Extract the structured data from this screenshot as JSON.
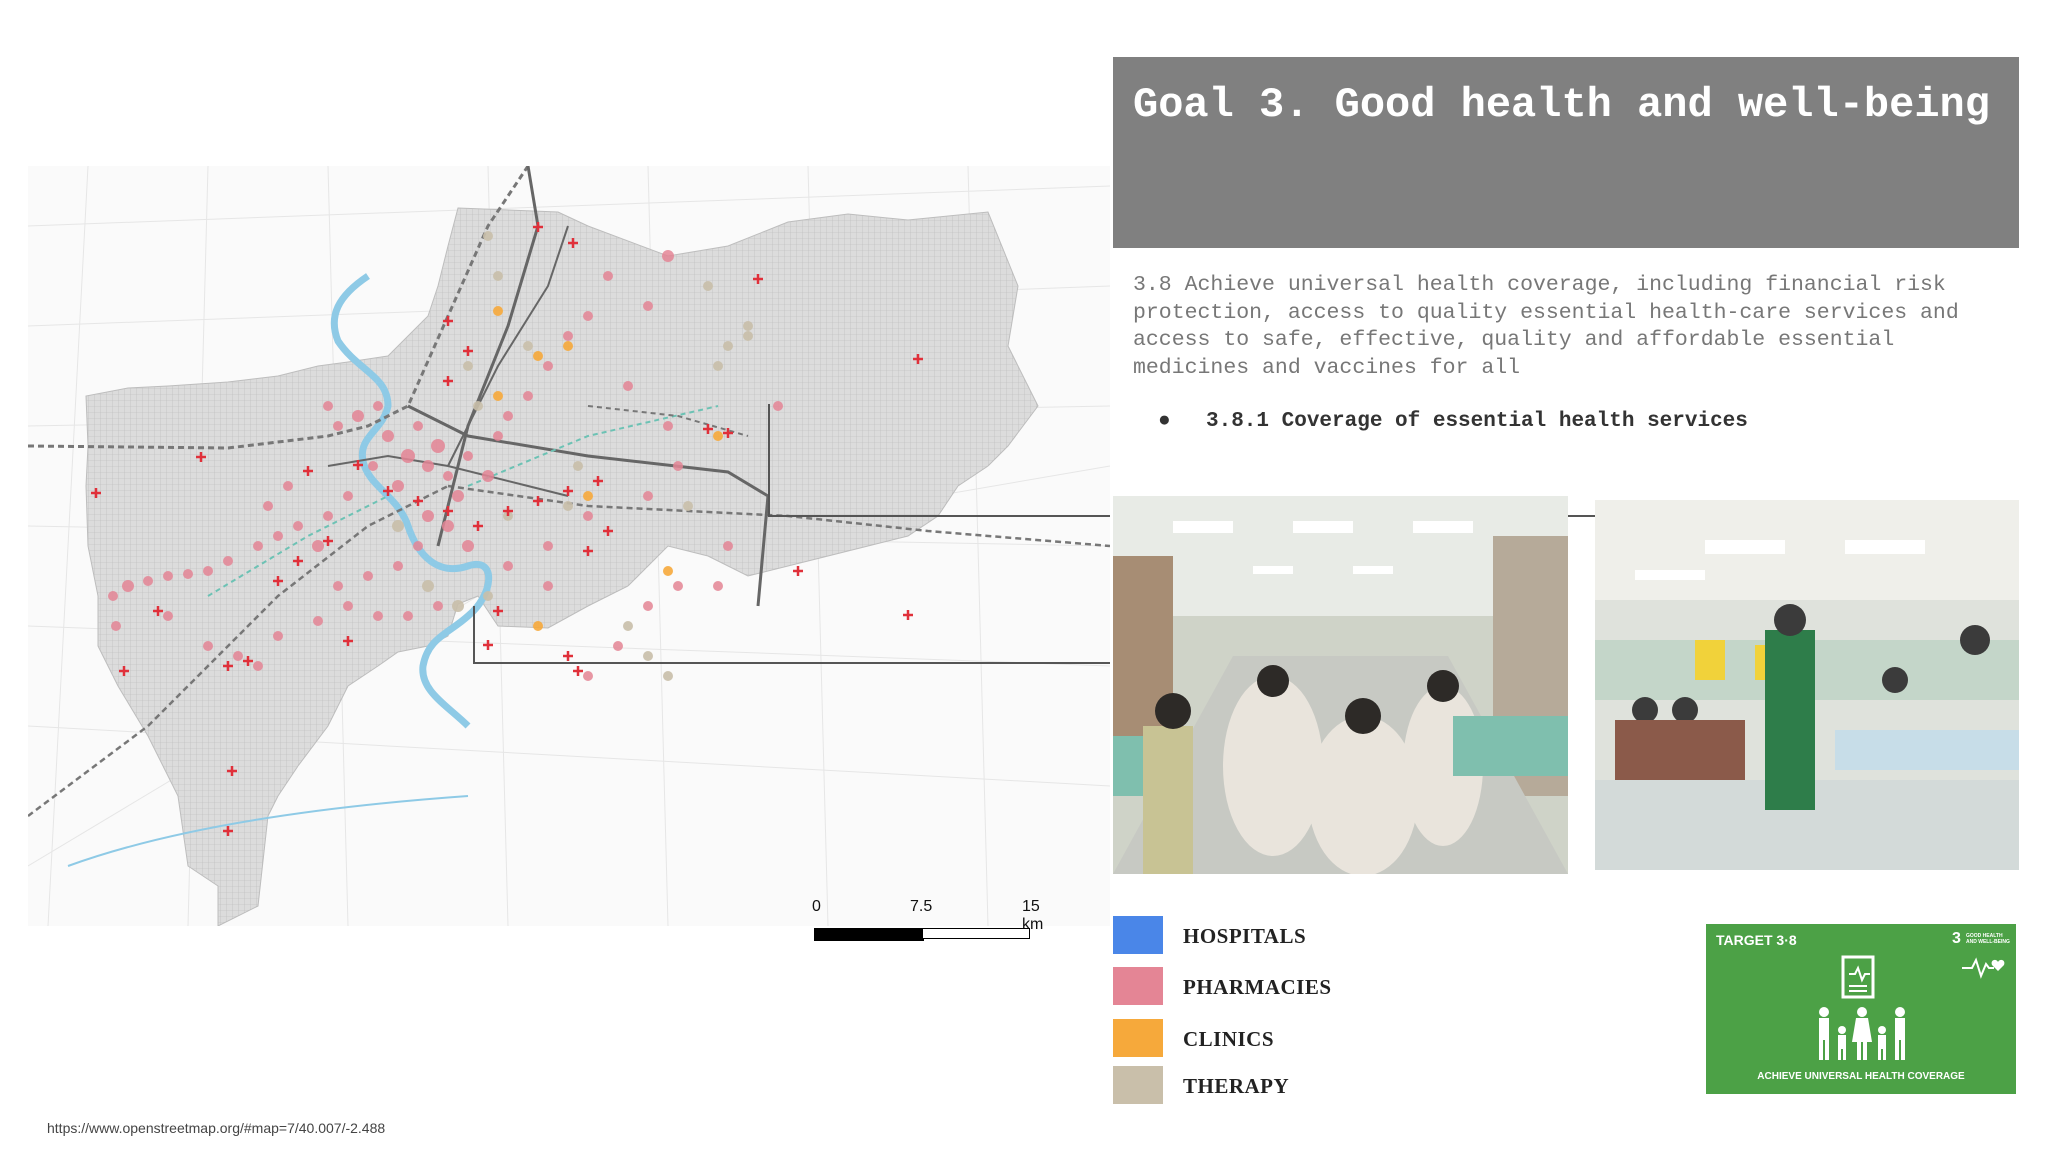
{
  "title": "Goal 3. Good health and well-being",
  "target_text": "3.8 Achieve universal health coverage, including financial risk protection, access to quality essential health-care services and access to safe, effective, quality and affordable essential medicines and vaccines for all",
  "indicator": {
    "bullet": "●",
    "text": "3.8.1 Coverage of essential health services"
  },
  "legend": [
    {
      "label": "HOSPITALS",
      "color": "#4a86e8"
    },
    {
      "label": "PHARMACIES",
      "color": "#e48595"
    },
    {
      "label": "CLINICS",
      "color": "#f6a93b"
    },
    {
      "label": "THERAPY",
      "color": "#c9bfaa"
    }
  ],
  "scale_bar": {
    "labels": [
      "0",
      "7.5",
      "15 km"
    ]
  },
  "sdg_badge": {
    "target": "TARGET 3·8",
    "goal_number": "3",
    "goal_name": "GOOD HEALTH AND WELL-BEING",
    "caption": "ACHIEVE UNIVERSAL HEALTH COVERAGE",
    "color": "#4ca146"
  },
  "source": "https://www.openstreetmap.org/#map=7/40.007/-2.488",
  "map_colors": {
    "area_fill": "#d9d9d9",
    "pharmacy": "#e48595",
    "therapy": "#c9bfaa",
    "clinic": "#f6a93b",
    "cross": "#e0303a",
    "river": "#8ecae6"
  }
}
